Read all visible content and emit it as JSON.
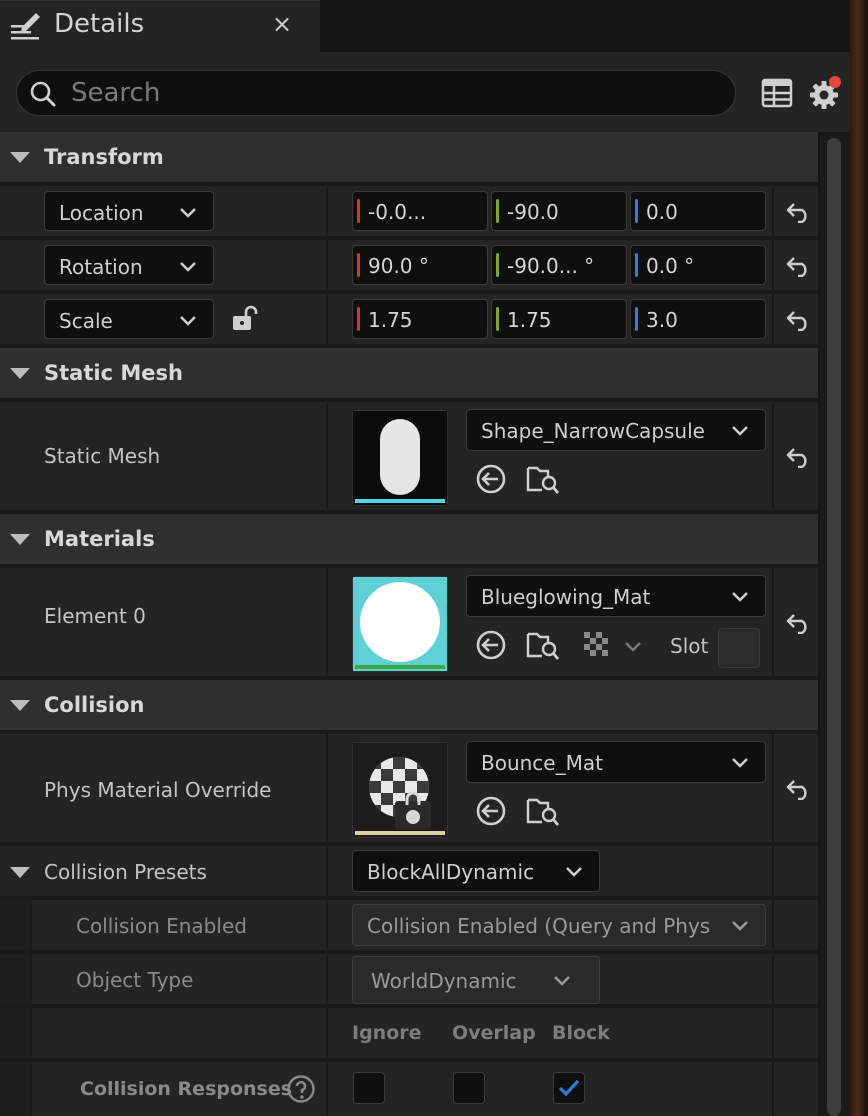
{
  "tab": {
    "title": "Details",
    "close_symbol": "×"
  },
  "search": {
    "placeholder": "Search"
  },
  "sections": {
    "transform": "Transform",
    "static_mesh": "Static Mesh",
    "materials": "Materials",
    "collision": "Collision"
  },
  "transform": {
    "location": {
      "label": "Location",
      "x": "-0.0...",
      "y": "-90.0",
      "z": "0.0"
    },
    "rotation": {
      "label": "Rotation",
      "x": "90.0 °",
      "y": "-90.0... °",
      "z": "0.0 °"
    },
    "scale": {
      "label": "Scale",
      "x": "1.75",
      "y": "1.75",
      "z": "3.0"
    }
  },
  "static_mesh": {
    "label": "Static Mesh",
    "asset": "Shape_NarrowCapsule"
  },
  "materials": {
    "label": "Element 0",
    "asset": "Blueglowing_Mat",
    "slot_label": "Slot"
  },
  "collision": {
    "phys_label": "Phys Material Override",
    "phys_asset": "Bounce_Mat",
    "presets_label": "Collision Presets",
    "presets_value": "BlockAllDynamic",
    "enabled_label": "Collision Enabled",
    "enabled_value": "Collision Enabled (Query and Physics",
    "object_type_label": "Object Type",
    "object_type_value": "WorldDynamic",
    "col_ignore": "Ignore",
    "col_overlap": "Overlap",
    "col_block": "Block",
    "responses_label": "Collision Responses",
    "responses": {
      "ignore": false,
      "overlap": false,
      "block": true
    }
  },
  "colors": {
    "x_axis": "#c8401e",
    "y_axis": "#7aa72a",
    "z_axis": "#3a78e0",
    "mesh_underline": "#4fd6e6",
    "material_underline": "#3aa83a",
    "physmat_underline": "#d8cfa0",
    "notification_dot": "#e8463a",
    "checkmark": "#2f7bd8"
  },
  "icons": [
    "details-pencil-icon",
    "close-icon",
    "search-icon",
    "table-view-icon",
    "settings-gear-icon",
    "chevron-down-icon",
    "unlock-icon",
    "reset-arrow-icon",
    "use-selected-icon",
    "browse-folder-icon",
    "checker-material-icon",
    "help-icon",
    "checkmark-icon"
  ]
}
